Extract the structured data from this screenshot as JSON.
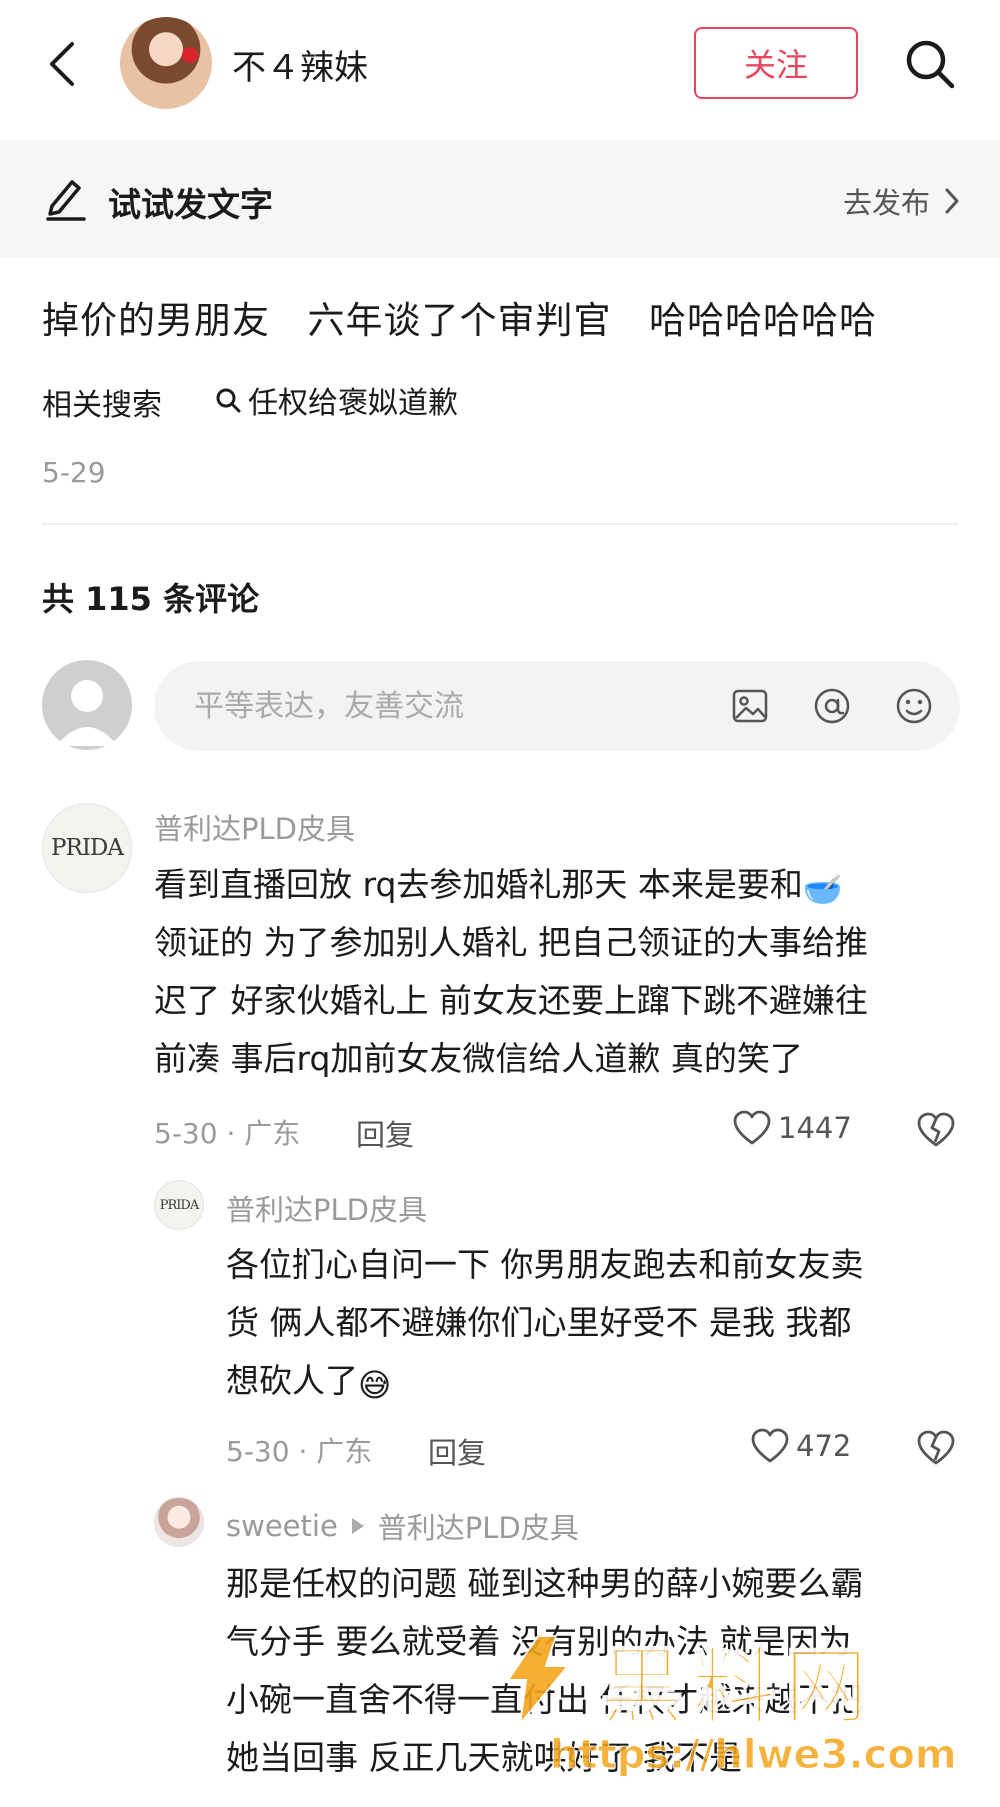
{
  "header": {
    "username": "不４辣妹",
    "follow_label": "关注"
  },
  "compose": {
    "label": "试试发文字",
    "publish_label": "去发布"
  },
  "post": {
    "title": "掉价的男朋友  六年谈了个审判官  哈哈哈哈哈哈",
    "related_label": "相关搜索",
    "related_query": "任权给褒姒道歉",
    "date": "5-29"
  },
  "comments_section": {
    "count_label": "共 115 条评论",
    "input_placeholder": "平等表达，友善交流"
  },
  "comments": [
    {
      "avatar_text": "PRIDA",
      "name": "普利达PLD皮具",
      "lines": [
        "看到直播回放 rq去参加婚礼那天 本来是要和",
        "领证的 为了参加别人婚礼 把自己领证的大事给推",
        "迟了 好家伙婚礼上 前女友还要上蹿下跳不避嫌往",
        "前凑 事后rq加前女友微信给人道歉 真的笑了"
      ],
      "inline_emoji": "🥣",
      "meta": "5-30 · 广东",
      "reply_label": "回复",
      "likes": "1447"
    },
    {
      "avatar_text": "PRIDA",
      "name": "普利达PLD皮具",
      "lines": [
        "各位扪心自问一下 你男朋友跑去和前女友卖",
        "货 俩人都不避嫌你们心里好受不 是我 我都",
        "想砍人了"
      ],
      "inline_emoji": "😅",
      "meta": "5-30 · 广东",
      "reply_label": "回复",
      "likes": "472"
    },
    {
      "name": "sweetie",
      "reply_to": "普利达PLD皮具",
      "lines": [
        "那是任权的问题  碰到这种男的薛小婉要么霸",
        "气分手  要么就受着 没有别的办法 就是因为",
        "小碗一直舍不得一直付出 任权才越来越不把",
        "她当回事  反正几天就哄好了 我不是"
      ]
    }
  ],
  "watermark": {
    "brand": "黑料网",
    "url": "https://hlwe3.com"
  },
  "colors": {
    "accent": "#e8455f",
    "muted_text": "#9a9a9a",
    "strip_bg": "#f6f6f6",
    "watermark": "#f4a51c"
  },
  "icons": [
    "back-arrow-icon",
    "search-icon",
    "pencil-icon",
    "chevron-right-icon",
    "image-icon",
    "at-icon",
    "smiley-icon",
    "heart-icon",
    "broken-heart-icon",
    "play-triangle-icon"
  ]
}
